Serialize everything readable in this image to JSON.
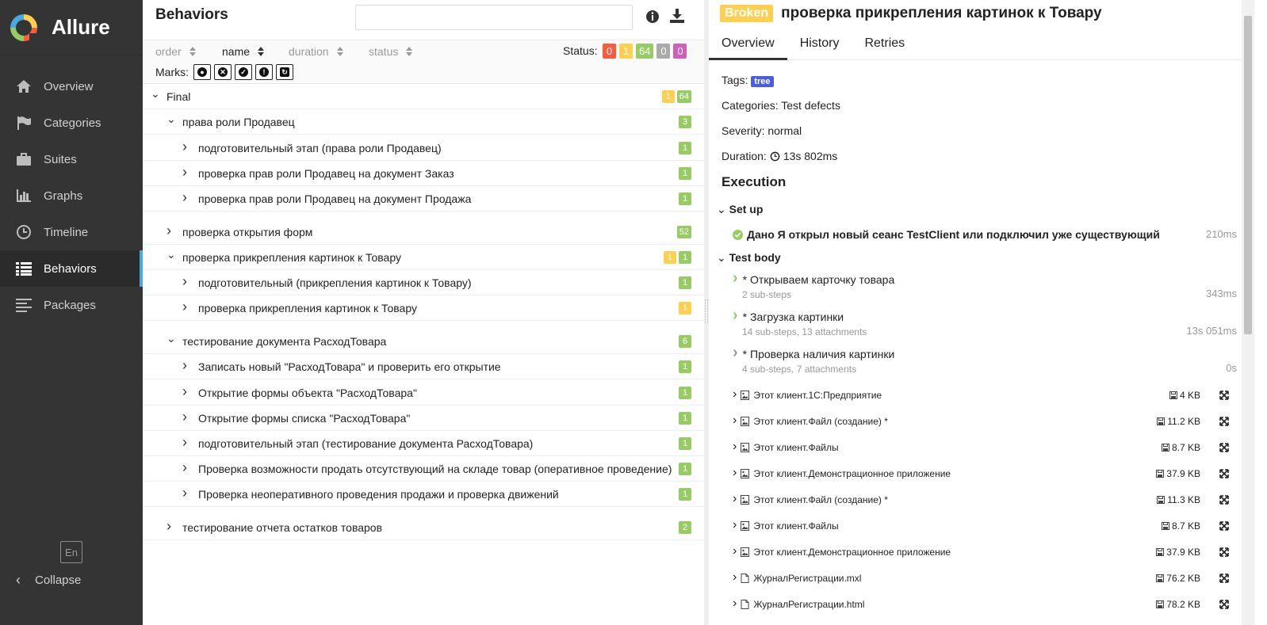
{
  "app": {
    "name": "Allure"
  },
  "sidebar": {
    "items": [
      {
        "label": "Overview",
        "icon": "home-icon"
      },
      {
        "label": "Categories",
        "icon": "flag-icon"
      },
      {
        "label": "Suites",
        "icon": "briefcase-icon"
      },
      {
        "label": "Graphs",
        "icon": "bar-chart-icon"
      },
      {
        "label": "Timeline",
        "icon": "clock-icon"
      },
      {
        "label": "Behaviors",
        "icon": "list-icon",
        "active": true
      },
      {
        "label": "Packages",
        "icon": "align-left-icon"
      }
    ],
    "language": "En",
    "collapse_label": "Collapse"
  },
  "behaviors": {
    "title": "Behaviors",
    "search": {
      "value": "",
      "placeholder": ""
    },
    "sorters": [
      "order",
      "name",
      "duration",
      "status"
    ],
    "status_label": "Status:",
    "status_counts": {
      "failed": "0",
      "broken": "1",
      "passed": "64",
      "skipped": "0",
      "unknown": "0"
    },
    "marks_label": "Marks:",
    "tree": [
      {
        "label": "Final",
        "level": 0,
        "expanded": true,
        "broken": "1",
        "passed": "64"
      },
      {
        "label": "права роли Продавец",
        "level": 1,
        "expanded": true,
        "passed": "3"
      },
      {
        "label": "подготовительный этап (права роли Продавец)",
        "level": 2,
        "passed": "1"
      },
      {
        "label": "проверка прав роли Продавец на документ Заказ",
        "level": 2,
        "passed": "1"
      },
      {
        "label": "проверка прав роли Продавец на документ Продажа",
        "level": 2,
        "passed": "1"
      },
      {
        "label": "проверка открытия форм",
        "level": 1,
        "expanded": false,
        "passed": "52"
      },
      {
        "label": "проверка прикрепления картинок к Товару",
        "level": 1,
        "expanded": true,
        "broken": "1",
        "passed": "1"
      },
      {
        "label": "подготовительный (прикрепления картинок к Товару)",
        "level": 2,
        "passed": "1"
      },
      {
        "label": "проверка прикрепления картинок к Товару",
        "level": 2,
        "broken": "1"
      },
      {
        "label": "тестирование документа РасходТовара",
        "level": 1,
        "expanded": true,
        "passed": "6"
      },
      {
        "label": "Записать новый \"РасходТовара\" и проверить его открытие",
        "level": 2,
        "passed": "1"
      },
      {
        "label": "Открытие формы объекта \"РасходТовара\"",
        "level": 2,
        "passed": "1"
      },
      {
        "label": "Открытие формы списка \"РасходТовара\"",
        "level": 2,
        "passed": "1"
      },
      {
        "label": "подготовительный этап (тестирование документа РасходТовара)",
        "level": 2,
        "passed": "1"
      },
      {
        "label": "Проверка возможности продать отсутствующий на складе товар (оперативное проведение)",
        "level": 2,
        "passed": "1"
      },
      {
        "label": "Проверка неоперативного проведения продажи и проверка движений",
        "level": 2,
        "passed": "1"
      },
      {
        "label": "тестирование отчета остатков товаров",
        "level": 1,
        "expanded": false,
        "passed": "2"
      }
    ]
  },
  "testcase": {
    "status": "Broken",
    "title": "проверка прикрепления картинок к Товару",
    "tabs": [
      "Overview",
      "History",
      "Retries"
    ],
    "tags_label": "Tags:",
    "tag": "tree",
    "categories_label": "Categories:",
    "categories_value": "Test defects",
    "severity_label": "Severity:",
    "severity_value": "normal",
    "duration_label": "Duration:",
    "duration_value": "13s 802ms",
    "execution_title": "Execution",
    "setup_label": "Set up",
    "setup_step": {
      "title": "Дано Я открыл новый сеанс TestClient или подключил уже существующий",
      "duration": "210ms"
    },
    "body_label": "Test body",
    "steps": [
      {
        "title": "* Открываем карточку товара",
        "sub": "2 sub-steps",
        "duration": "343ms",
        "status": "passed"
      },
      {
        "title": "* Загрузка картинки",
        "sub": "14 sub-steps, 13 attachments",
        "duration": "13s 051ms",
        "status": "passed"
      },
      {
        "title": "* Проверка наличия картинки",
        "sub": "4 sub-steps, 7 attachments",
        "duration": "0s",
        "status": "broken"
      }
    ],
    "attachments": [
      {
        "name": "Этот клиент.1С:Предприятие",
        "size": "4 KB",
        "icon": "image-icon"
      },
      {
        "name": "Этот клиент.Файл (создание) *",
        "size": "11.2 KB",
        "icon": "image-icon"
      },
      {
        "name": "Этот клиент.Файлы",
        "size": "8.7 KB",
        "icon": "image-icon"
      },
      {
        "name": "Этот клиент.Демонстрационное приложение",
        "size": "37.9 KB",
        "icon": "image-icon"
      },
      {
        "name": "Этот клиент.Файл (создание) *",
        "size": "11.3 KB",
        "icon": "image-icon"
      },
      {
        "name": "Этот клиент.Файлы",
        "size": "8.7 KB",
        "icon": "image-icon"
      },
      {
        "name": "Этот клиент.Демонстрационное приложение",
        "size": "37.9 KB",
        "icon": "image-icon"
      },
      {
        "name": "ЖурналРегистрации.mxl",
        "size": "76.2 KB",
        "icon": "file-icon"
      },
      {
        "name": "ЖурналРегистрации.html",
        "size": "78.2 KB",
        "icon": "file-icon"
      }
    ]
  },
  "colors": {
    "passed": "#97cc64",
    "broken": "#ffd050",
    "failed": "#fd5a3e",
    "skipped": "#aaaaaa",
    "unknown": "#d35ebe",
    "sidebar_bg": "#343434",
    "accent": "#4aa8e0",
    "tag": "#4a5ee0"
  }
}
